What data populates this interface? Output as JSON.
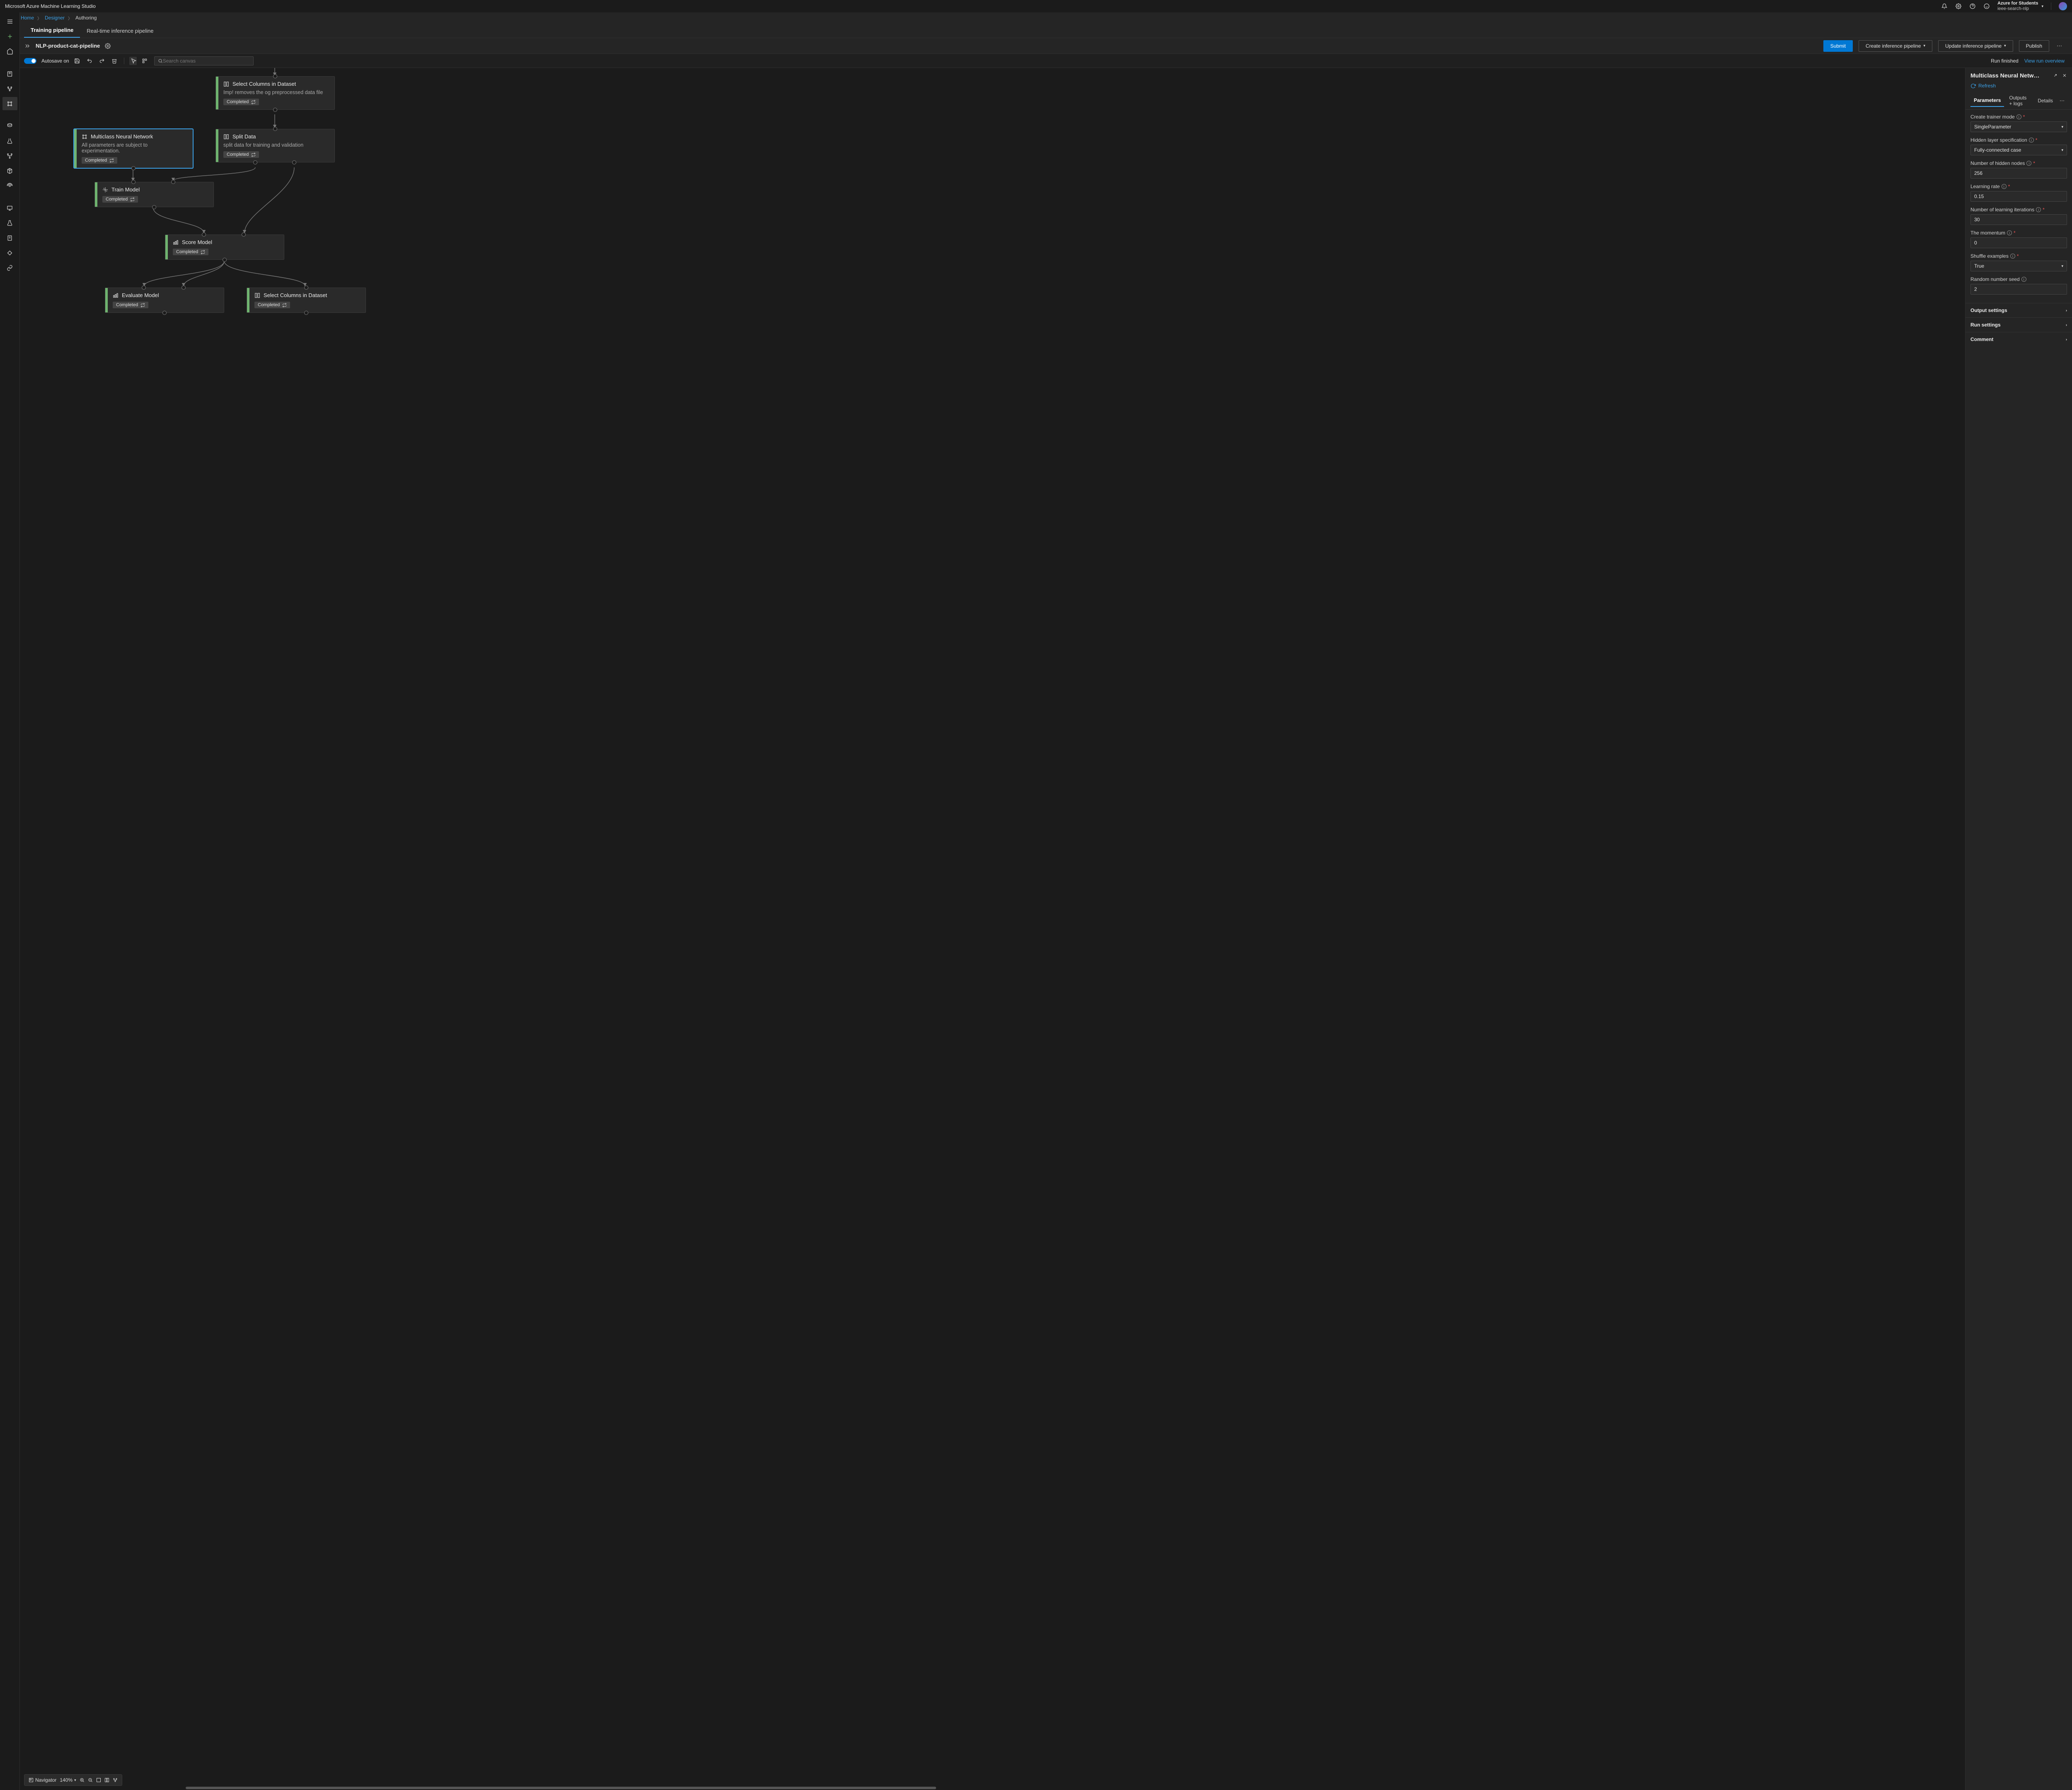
{
  "app_title": "Microsoft Azure Machine Learning Studio",
  "subscription": {
    "name": "Azure for Students",
    "workspace": "ieee-search-nlp"
  },
  "breadcrumb": {
    "home": "Home",
    "designer": "Designer",
    "current": "Authoring"
  },
  "subtabs": {
    "training": "Training pipeline",
    "inference": "Real-time inference pipeline"
  },
  "pipeline": {
    "name": "NLP-product-cat-pipeline",
    "submit": "Submit",
    "create_inf": "Create inference pipeline",
    "update_inf": "Update inference pipeline",
    "publish": "Publish"
  },
  "toolbar": {
    "autosave": "Autosave on",
    "search_placeholder": "Search canvas",
    "run_status": "Run finished",
    "view_overview": "View run overview"
  },
  "nodes": {
    "n1": {
      "title": "Select Columns in Dataset",
      "desc": "Imp! removes the og preprocessed data file",
      "status": "Completed"
    },
    "n2": {
      "title": "Multiclass Neural Network",
      "desc": "All parameters are subject to experimentation.",
      "status": "Completed"
    },
    "n3": {
      "title": "Split Data",
      "desc": "split data for training and validation",
      "status": "Completed"
    },
    "n4": {
      "title": "Train Model",
      "status": "Completed"
    },
    "n5": {
      "title": "Score Model",
      "status": "Completed"
    },
    "n6": {
      "title": "Evaluate Model",
      "status": "Completed"
    },
    "n7": {
      "title": "Select Columns in Dataset",
      "status": "Completed"
    }
  },
  "panel": {
    "title": "Multiclass Neural Netw…",
    "refresh": "Refresh",
    "tabs": {
      "params": "Parameters",
      "outputs": "Outputs + logs",
      "details": "Details"
    },
    "fields": {
      "trainer_mode": {
        "label": "Create trainer mode",
        "value": "SingleParameter"
      },
      "hidden_spec": {
        "label": "Hidden layer specification",
        "value": "Fully-connected case"
      },
      "hidden_nodes": {
        "label": "Number of hidden nodes",
        "value": "256"
      },
      "learning_rate": {
        "label": "Learning rate",
        "value": "0.15"
      },
      "iterations": {
        "label": "Number of learning iterations",
        "value": "30"
      },
      "momentum": {
        "label": "The momentum",
        "value": "0"
      },
      "shuffle": {
        "label": "Shuffle examples",
        "value": "True"
      },
      "seed": {
        "label": "Random number seed",
        "value": "2"
      }
    },
    "sections": {
      "output": "Output settings",
      "run": "Run settings",
      "comment": "Comment"
    }
  },
  "bottombar": {
    "navigator": "Navigator",
    "zoom": "140%"
  }
}
